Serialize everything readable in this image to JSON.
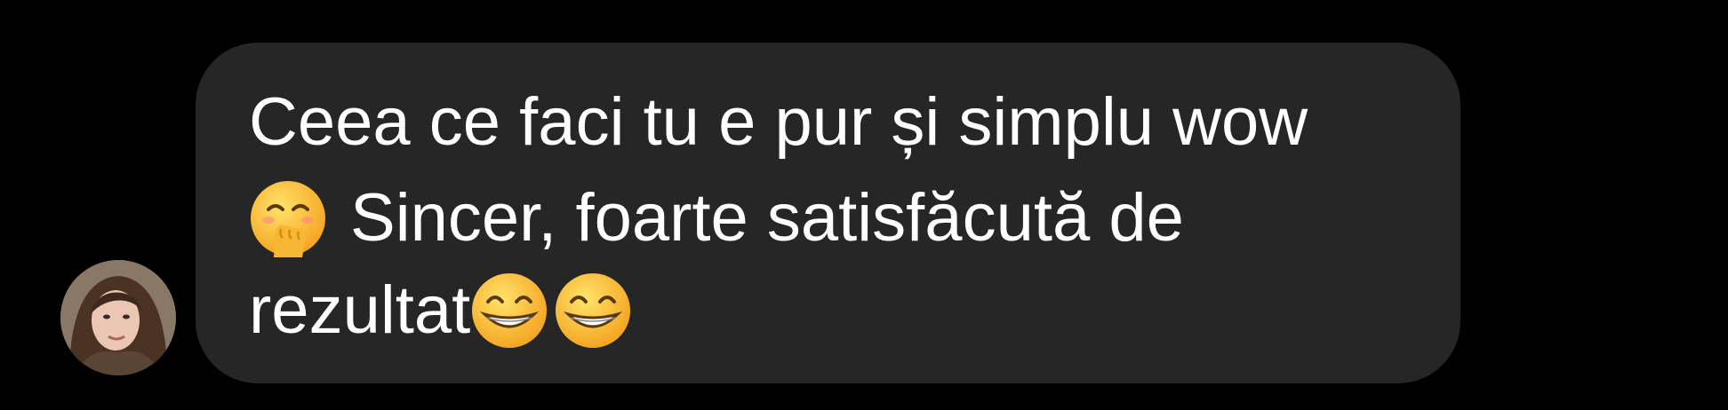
{
  "message": {
    "line1": "Ceea ce faci tu e pur și simplu wow",
    "line2_text": "Sincer, foarte satisfăcută de",
    "line3_text": "rezultat",
    "emojis": [
      "face-with-hand-over-mouth",
      "grinning-face-with-smiling-eyes",
      "grinning-face-with-smiling-eyes"
    ]
  },
  "sender": {
    "avatar_icon": "user-avatar-photo"
  },
  "colors": {
    "background": "#000000",
    "bubble": "#262626",
    "text": "#ffffff"
  }
}
